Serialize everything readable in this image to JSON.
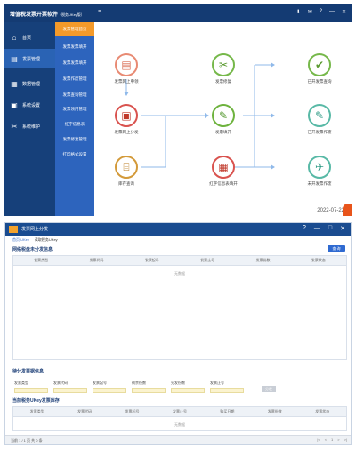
{
  "app1": {
    "title_main": "增值税发票开票软件",
    "title_sub": "（税务UKey版）",
    "menu_icon": "≡",
    "toolbar_icons": [
      "⬇",
      "✉",
      "?",
      "—",
      "✕"
    ],
    "sidebar": [
      {
        "icon": "home-icon",
        "glyph": "⌂",
        "label": "首页"
      },
      {
        "icon": "printer-icon",
        "glyph": "▤",
        "label": "发票管理"
      },
      {
        "icon": "data-icon",
        "glyph": "▦",
        "label": "数据管理"
      },
      {
        "icon": "settings-icon",
        "glyph": "▣",
        "label": "系统设置"
      },
      {
        "icon": "tools-icon",
        "glyph": "✂",
        "label": "系统维护"
      }
    ],
    "submenu": [
      "发票管理首页",
      "发票发票填开",
      "发票发票填开",
      "发票作废管理",
      "发票查询管理",
      "发票领用管理",
      "红字信息表",
      "发票修复管理",
      "打印格式设置"
    ],
    "flow_nodes": [
      {
        "label": "发票网上申领"
      },
      {
        "label": "发票网上分发"
      },
      {
        "label": "库存查询"
      },
      {
        "label": "发票修复"
      },
      {
        "label": "发票填开"
      },
      {
        "label": "红字信息表填开"
      },
      {
        "label": "已开发票查询"
      },
      {
        "label": "已开发票作废"
      },
      {
        "label": "未开发票作废"
      }
    ],
    "date": "2022-07-22",
    "colors": {
      "titlebar": "#143b73",
      "sidebar": "#16407a",
      "submenu": "#2d64bd",
      "active_sub": "#f49a2a"
    }
  },
  "app2": {
    "title": "发票网上分发",
    "toolbar_icons": [
      "?",
      "—",
      "□",
      "✕"
    ],
    "crumbs": [
      "首页 UKey",
      "读取税务UKey"
    ],
    "section1": "网络税盘未分发信息",
    "section2": "待分发票据信息",
    "section3": "当前税务UKey发票库存",
    "query_btn": "查 询",
    "table1_headers": [
      "发票类型",
      "发票代码",
      "发票起号",
      "发票止号",
      "发票份数",
      "发票状态"
    ],
    "table3_headers": [
      "发票类型",
      "发票代码",
      "发票起号",
      "发票止号",
      "购买日期",
      "发票份数",
      "发票状态"
    ],
    "empty_text": "无数据",
    "fields": [
      "发票类型",
      "发票代码",
      "发票起号",
      "剩余份数",
      "分发份数",
      "发票止号"
    ],
    "gray_btn": "分发",
    "footer_left": "当前 1 / 1 页 共 0 条",
    "footer_right": [
      "|<",
      "<",
      "1",
      ">",
      ">|"
    ]
  }
}
